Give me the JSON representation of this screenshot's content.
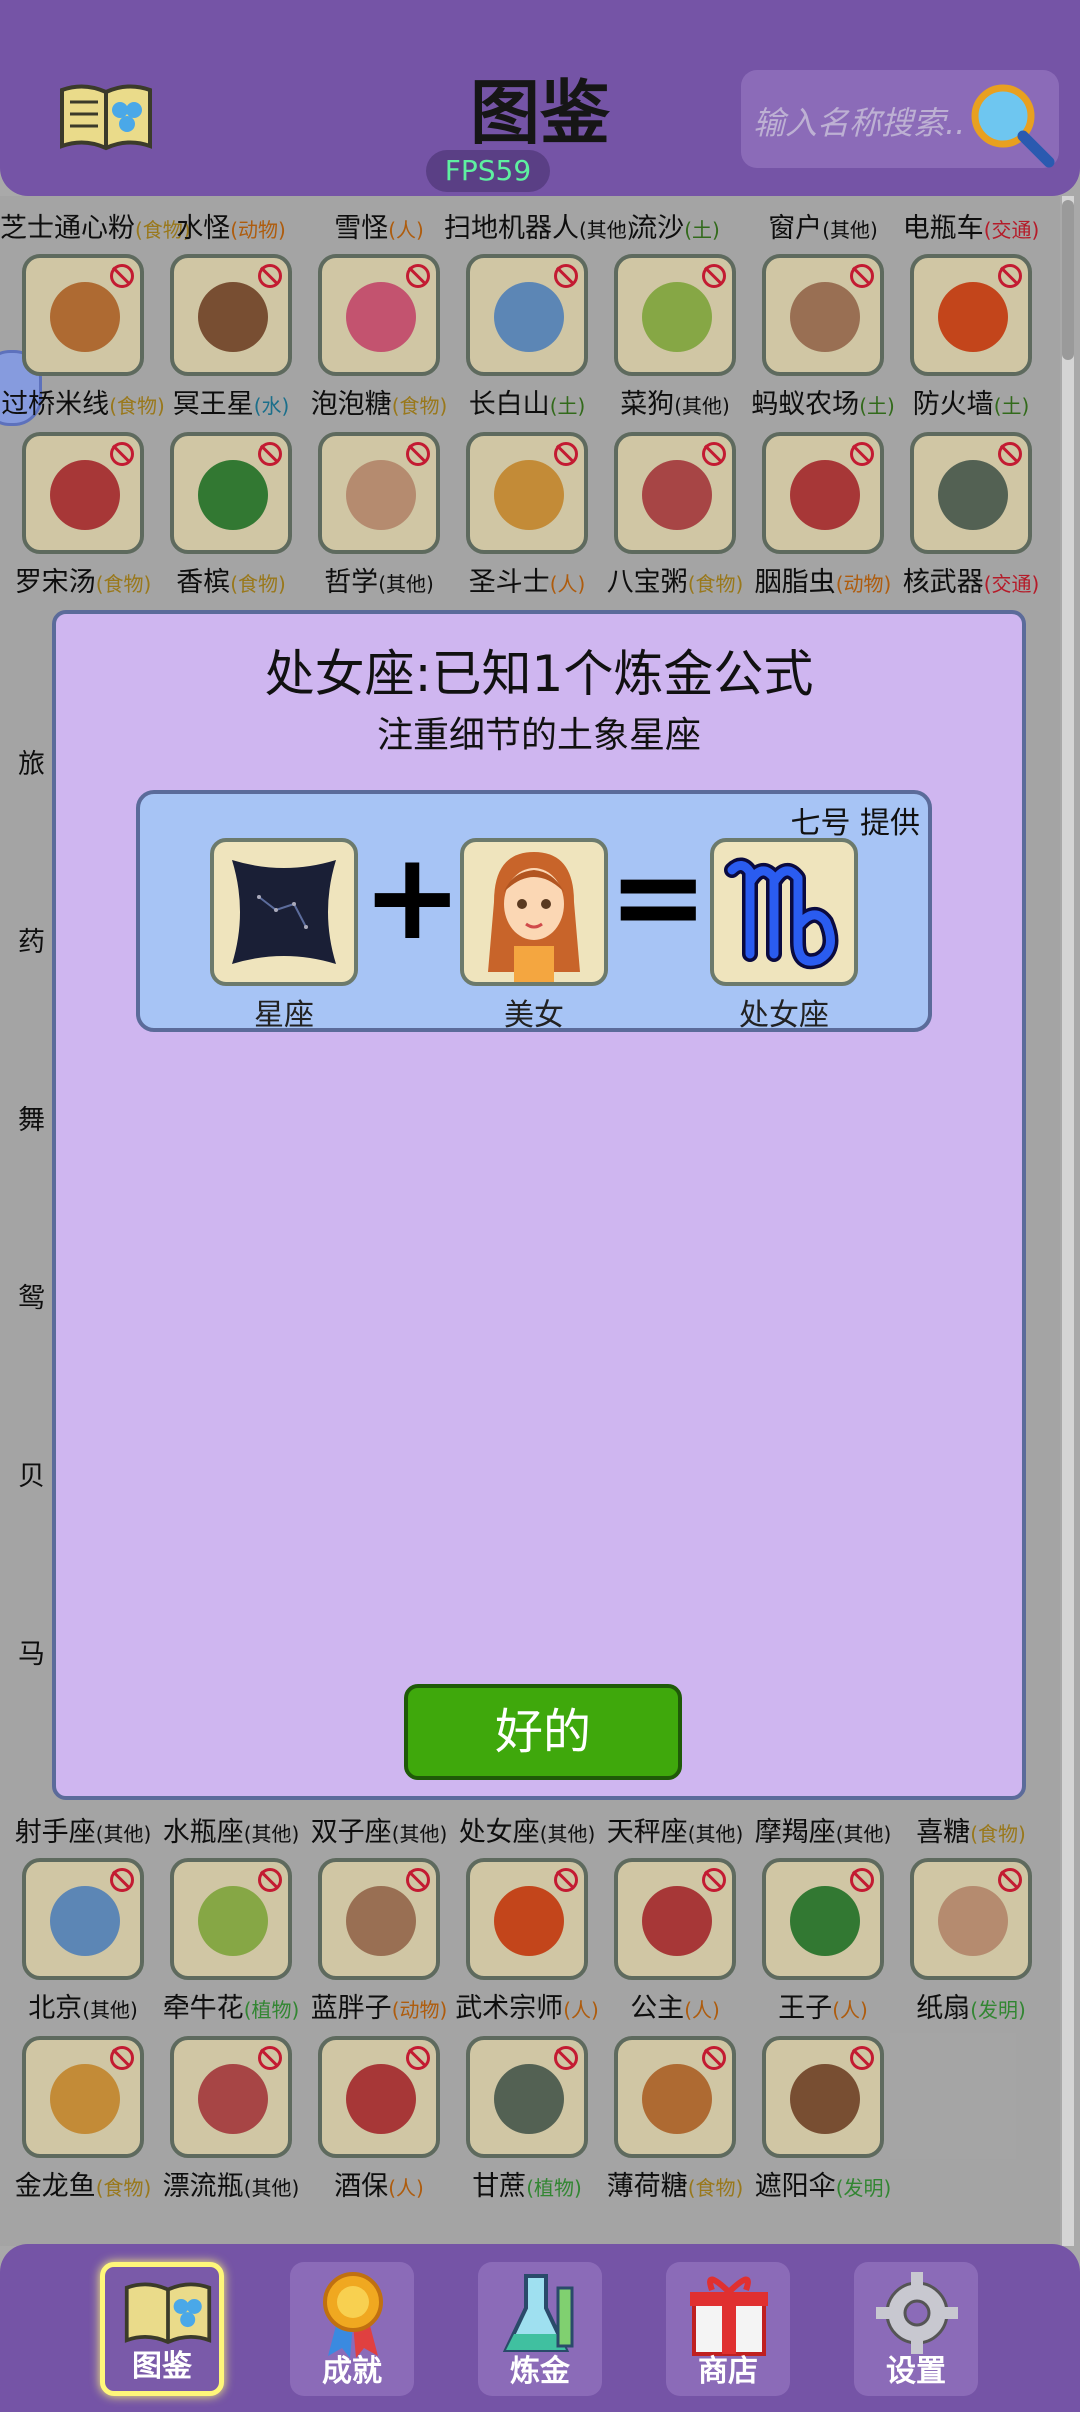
{
  "header": {
    "title": "图鉴",
    "search_placeholder": "输入名称搜索..",
    "fps": "FPS59"
  },
  "grid": {
    "top_labels": [
      {
        "name": "芝士通心粉",
        "cat": "(食物)",
        "color": "#b08a20"
      },
      {
        "name": "水怪",
        "cat": "(动物)",
        "color": "#c86a10"
      },
      {
        "name": "雪怪",
        "cat": "(人)",
        "color": "#c86a10"
      },
      {
        "name": "扫地机器人",
        "cat": "(其他)",
        "color": "#111111"
      },
      {
        "name": "流沙",
        "cat": "(土)",
        "color": "#3a7a20"
      },
      {
        "name": "窗户",
        "cat": "(其他)",
        "color": "#111111"
      },
      {
        "name": "电瓶车",
        "cat": "(交通)",
        "color": "#d02030"
      }
    ],
    "rows": [
      [
        {
          "name": "过桥米线",
          "cat": "(食物)",
          "color": "#b08a20",
          "icon": "noodle-bowl-icon"
        },
        {
          "name": "冥王星",
          "cat": "(水)",
          "color": "#2080a0",
          "icon": "planet-icon"
        },
        {
          "name": "泡泡糖",
          "cat": "(食物)",
          "color": "#b08a20",
          "icon": "gum-balls-icon"
        },
        {
          "name": "长白山",
          "cat": "(土)",
          "color": "#3a7a20",
          "icon": "mountain-icon"
        },
        {
          "name": "菜狗",
          "cat": "(其他)",
          "color": "#111111",
          "icon": "green-dog-icon"
        },
        {
          "name": "蚂蚁农场",
          "cat": "(土)",
          "color": "#3a7a20",
          "icon": "ant-farm-icon"
        },
        {
          "name": "防火墙",
          "cat": "(土)",
          "color": "#3a7a20",
          "icon": "firewall-icon"
        }
      ],
      [
        {
          "name": "罗宋汤",
          "cat": "(食物)",
          "color": "#b08a20",
          "icon": "soup-pot-icon"
        },
        {
          "name": "香槟",
          "cat": "(食物)",
          "color": "#b08a20",
          "icon": "champagne-icon"
        },
        {
          "name": "哲学",
          "cat": "(其他)",
          "color": "#111111",
          "icon": "philosopher-icon"
        },
        {
          "name": "圣斗士",
          "cat": "(人)",
          "color": "#c86a10",
          "icon": "saint-warrior-icon"
        },
        {
          "name": "八宝粥",
          "cat": "(食物)",
          "color": "#b08a20",
          "icon": "porridge-icon"
        },
        {
          "name": "胭脂虫",
          "cat": "(动物)",
          "color": "#c86a10",
          "icon": "cochineal-icon"
        },
        {
          "name": "核武器",
          "cat": "(交通)",
          "color": "#d02030",
          "icon": "missile-truck-icon"
        }
      ]
    ],
    "left_peek": [
      "旅",
      "药",
      "舞",
      "鸳",
      "贝",
      "马"
    ],
    "label_row": [
      {
        "name": "射手座",
        "cat": "(其他)",
        "color": "#111111"
      },
      {
        "name": "水瓶座",
        "cat": "(其他)",
        "color": "#111111"
      },
      {
        "name": "双子座",
        "cat": "(其他)",
        "color": "#111111"
      },
      {
        "name": "处女座",
        "cat": "(其他)",
        "color": "#111111"
      },
      {
        "name": "天秤座",
        "cat": "(其他)",
        "color": "#111111"
      },
      {
        "name": "摩羯座",
        "cat": "(其他)",
        "color": "#111111"
      },
      {
        "name": "喜糖",
        "cat": "(食物)",
        "color": "#b08a20"
      }
    ],
    "bottom_rows": [
      [
        {
          "name": "北京",
          "cat": "(其他)",
          "color": "#111111",
          "icon": "blackboard-icon"
        },
        {
          "name": "牵牛花",
          "cat": "(植物)",
          "color": "#3a9a3a",
          "icon": "morning-glory-icon"
        },
        {
          "name": "蓝胖子",
          "cat": "(动物)",
          "color": "#c86a10",
          "icon": "blue-robot-cat-icon"
        },
        {
          "name": "武术宗师",
          "cat": "(人)",
          "color": "#c86a10",
          "icon": "martial-artist-icon"
        },
        {
          "name": "公主",
          "cat": "(人)",
          "color": "#c86a10",
          "icon": "princess-icon"
        },
        {
          "name": "王子",
          "cat": "(人)",
          "color": "#c86a10",
          "icon": "prince-icon"
        },
        {
          "name": "纸扇",
          "cat": "(发明)",
          "color": "#3a9a3a",
          "icon": "paper-fan-icon"
        }
      ],
      [
        {
          "name": "金龙鱼",
          "cat": "(食物)",
          "color": "#b08a20",
          "icon": "oil-bottle-icon"
        },
        {
          "name": "漂流瓶",
          "cat": "(其他)",
          "color": "#111111",
          "icon": "message-bottle-icon"
        },
        {
          "name": "酒保",
          "cat": "(人)",
          "color": "#c86a10",
          "icon": "bartender-icon"
        },
        {
          "name": "甘蔗",
          "cat": "(植物)",
          "color": "#3a9a3a",
          "icon": "sugarcane-icon"
        },
        {
          "name": "薄荷糖",
          "cat": "(食物)",
          "color": "#b08a20",
          "icon": "mint-candy-icon"
        },
        {
          "name": "遮阳伞",
          "cat": "(发明)",
          "color": "#3a9a3a",
          "icon": "beach-umbrella-icon"
        }
      ]
    ]
  },
  "dialog": {
    "title": "处女座:已知1个炼金公式",
    "subtitle": "注重细节的土象星座",
    "provider": "七号 提供",
    "plus": "+",
    "equals": "=",
    "ingredient1": {
      "label": "星座",
      "icon": "constellation-icon"
    },
    "ingredient2": {
      "label": "美女",
      "icon": "beauty-girl-icon"
    },
    "result": {
      "label": "处女座",
      "icon": "virgo-symbol-icon"
    },
    "ok_label": "好的"
  },
  "nav": {
    "encyclopedia": "图鉴",
    "achievements": "成就",
    "alchemy": "炼金",
    "shop": "商店",
    "settings": "设置"
  },
  "colors": {
    "header": "#7554a6",
    "dialog_bg": "#cfb6f0",
    "recipe_bg": "#a7c4f5",
    "ok_button": "#3fa80c",
    "tile": "#efe4bd"
  }
}
